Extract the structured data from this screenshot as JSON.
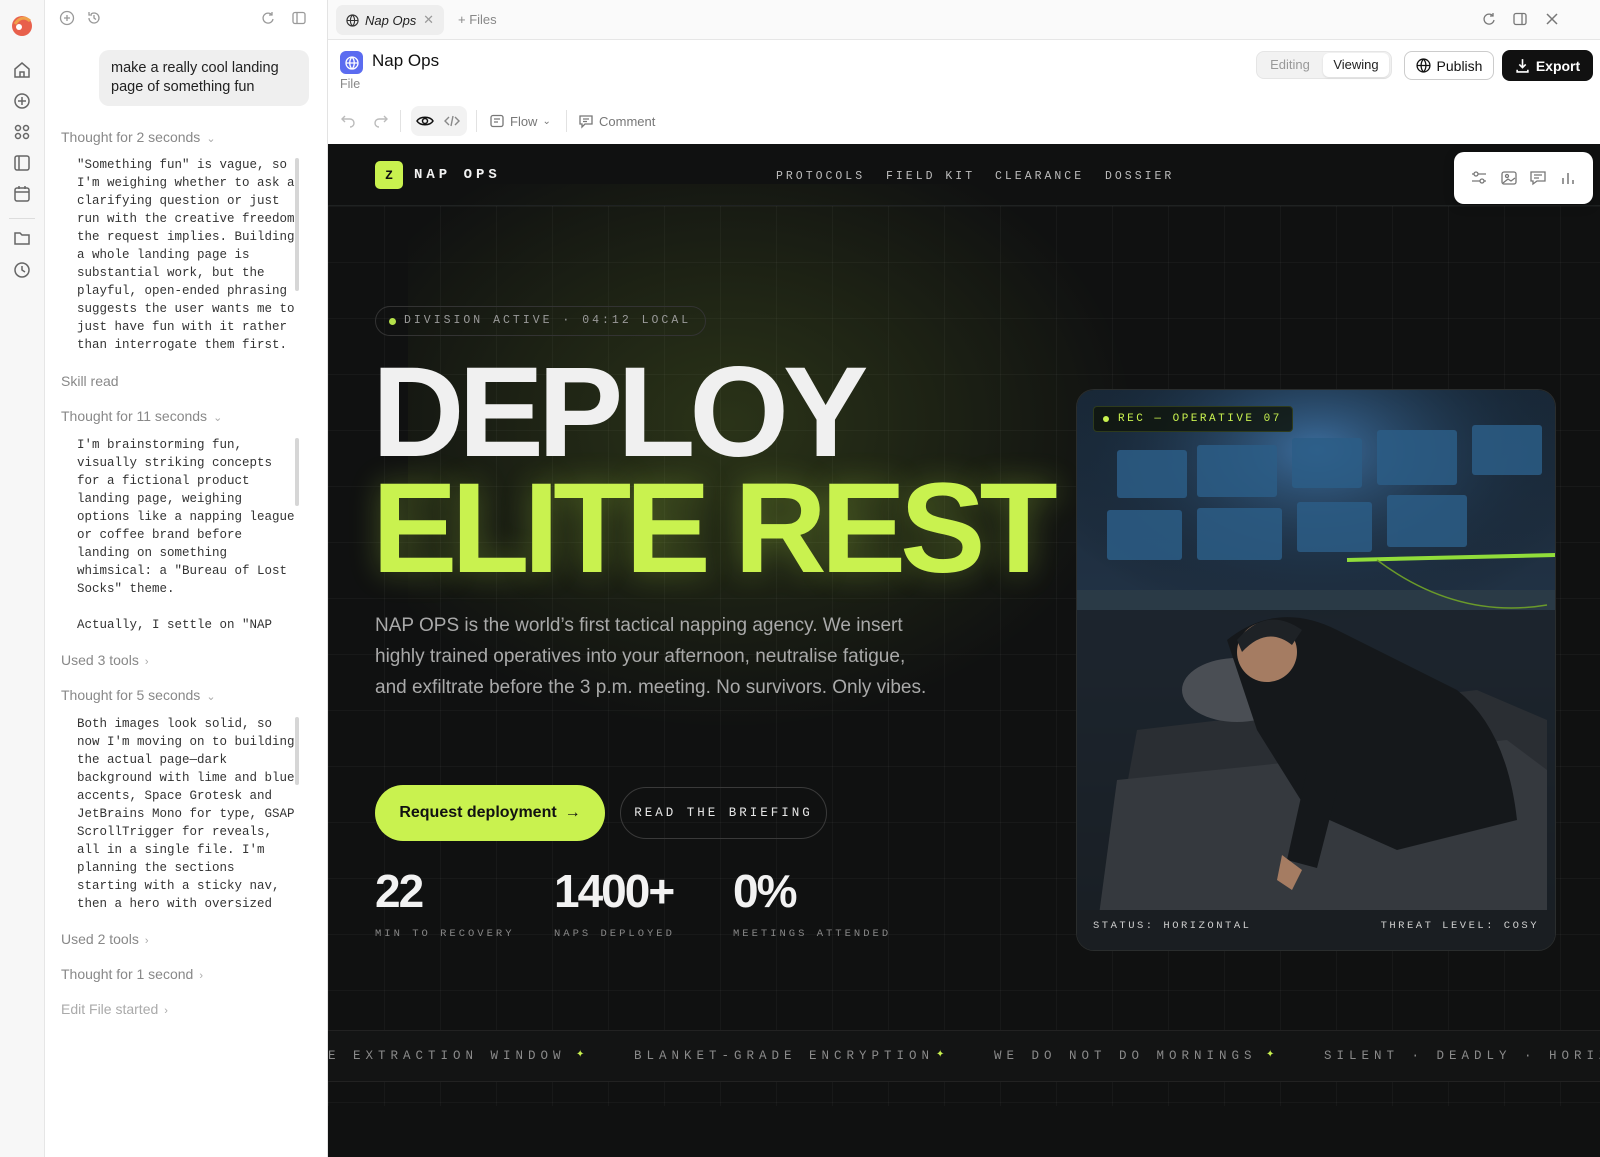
{
  "chat": {
    "prompt": "make a really cool landing page of something fun",
    "sections": [
      {
        "label": "Thought for 2 seconds",
        "text": "\"Something fun\" is vague, so\nI'm weighing whether to ask a\nclarifying question or just\nrun with the creative freedom\nthe request implies. Building\na whole landing page is\nsubstantial work, but the\nplayful, open-ended phrasing\nsuggests the user wants me to\njust have fun with it rather\nthan interrogate them first."
      },
      {
        "label": "Skill read"
      },
      {
        "label": "Thought for 11 seconds",
        "text": "I'm brainstorming fun,\nvisually striking concepts\nfor a fictional product\nlanding page, weighing\noptions like a napping league\nor coffee brand before\nlanding on something\nwhimsical: a \"Bureau of Lost\nSocks\" theme.\n\nActually, I settle on \"NAP"
      },
      {
        "label": "Used 3 tools"
      },
      {
        "label": "Thought for 5 seconds",
        "text": "Both images look solid, so\nnow I'm moving on to building\nthe actual page—dark\nbackground with lime and blue\naccents, Space Grotesk and\nJetBrains Mono for type, GSAP\nScrollTrigger for reveals,\nall in a single file. I'm\nplanning the sections\nstarting with a sticky nav,\nthen a hero with oversized"
      },
      {
        "label": "Used 2 tools"
      },
      {
        "label": "Thought for 1 second"
      },
      {
        "label": "Edit File started"
      }
    ]
  },
  "tabs": {
    "active": "Nap Ops",
    "add_files": "+ Files"
  },
  "header": {
    "title": "Nap Ops",
    "subtitle": "File",
    "mode_editing": "Editing",
    "mode_viewing": "Viewing",
    "publish": "Publish",
    "export": "Export",
    "flow": "Flow",
    "comment": "Comment"
  },
  "site": {
    "brand_mark": "Z",
    "brand_name": "NAP OPS",
    "nav": [
      "PROTOCOLS",
      "FIELD KIT",
      "CLEARANCE",
      "DOSSIER"
    ],
    "status_pill": "DIVISION ACTIVE · 04:12 LOCAL",
    "headline_1": "DEPLOY",
    "headline_2": "ELITE REST",
    "lede": "NAP OPS is the world’s first tactical napping agency. We insert highly trained operatives into your afternoon, neutralise fatigue, and exfiltrate before the 3 p.m. meeting. No survivors. Only vibes.",
    "cta_primary": "Request deployment",
    "cta_arrow": "→",
    "cta_secondary": "READ THE BRIEFING",
    "stats": [
      {
        "value": "22",
        "label": "MIN TO RECOVERY"
      },
      {
        "value": "1400+",
        "label": "NAPS DEPLOYED"
      },
      {
        "value": "0%",
        "label": "MEETINGS ATTENDED"
      }
    ],
    "photo": {
      "badge": "REC — OPERATIVE 07",
      "status": "STATUS: HORIZONTAL",
      "threat": "THREAT LEVEL: COSY"
    },
    "ticker": [
      "E EXTRACTION WINDOW",
      "BLANKET-GRADE ENCRYPTION",
      "WE DO NOT DO MORNINGS",
      "SILENT · DEADLY · HORIZO"
    ],
    "colors": {
      "accent": "#c9f24f",
      "background": "#101111"
    }
  }
}
